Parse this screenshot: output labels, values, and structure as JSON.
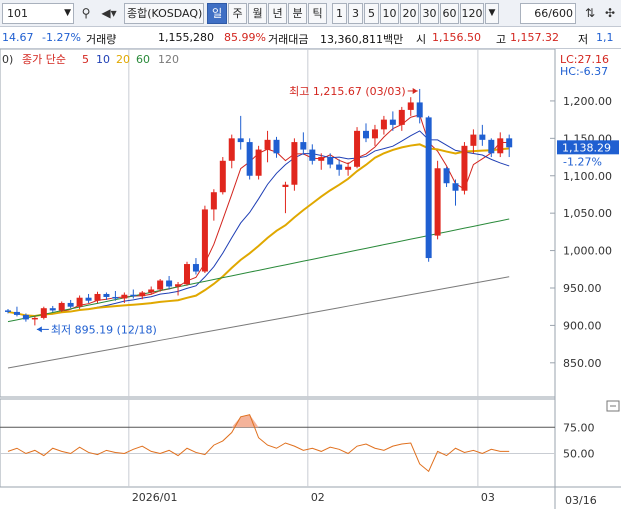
{
  "toolbar": {
    "code": "101",
    "market": "종합(KOSDAQ)",
    "periods": [
      "일",
      "주",
      "월",
      "년",
      "분",
      "틱"
    ],
    "active_period": "일",
    "intervals": [
      "1",
      "3",
      "5",
      "10",
      "20",
      "30",
      "60",
      "120"
    ],
    "bars_count": "66",
    "bars_total": "/600"
  },
  "quote": {
    "change": "14.67",
    "change_pct": "-1.27%",
    "volume_label": "거래량",
    "volume": "1,155,280",
    "volume_ratio": "85.99%",
    "amount_label": "거래대금",
    "amount": "13,360,811백만",
    "open_label": "시",
    "open": "1,156.50",
    "high_label": "고",
    "high": "1,157.32",
    "low_label": "저",
    "low_partial": "1,1"
  },
  "legend": {
    "prefix": "0)",
    "title": "종가 단순",
    "ma": [
      {
        "label": "5",
        "color": "#d3261f"
      },
      {
        "label": "10",
        "color": "#1f3fb5"
      },
      {
        "label": "20",
        "color": "#e0a800"
      },
      {
        "label": "60",
        "color": "#2a8a3a"
      },
      {
        "label": "120",
        "color": "#7a7a7a"
      }
    ]
  },
  "chart_data": {
    "type": "candlestick",
    "price_axis": [
      1200,
      1150,
      1100,
      1050,
      1000,
      950,
      900,
      850
    ],
    "price_axis_labels": [
      "1,200.00",
      "1,150.00",
      "1,100.00",
      "1,050.00",
      "1,000.00",
      "950.00",
      "900.00",
      "850.00"
    ],
    "ylim": [
      815,
      1240
    ],
    "current_price": "1,138.29",
    "current_change": "-1.27%",
    "lc": "LC:27.16",
    "hc": "HC:-6.37",
    "high_annotation": "최고 1,215.67 (03/03)",
    "low_annotation": "최저 895.19 (12/18)",
    "x_labels": [
      {
        "text": "2026/01",
        "index": 14
      },
      {
        "text": "02",
        "index": 34
      },
      {
        "text": "03",
        "index": 53
      }
    ],
    "date_label": "03/16",
    "candles": [
      [
        920,
        922,
        916,
        918
      ],
      [
        918,
        925,
        912,
        914
      ],
      [
        914,
        916,
        905,
        908
      ],
      [
        908,
        912,
        900,
        910
      ],
      [
        910,
        925,
        908,
        923
      ],
      [
        923,
        926,
        918,
        920
      ],
      [
        920,
        932,
        918,
        930
      ],
      [
        930,
        934,
        923,
        925
      ],
      [
        925,
        940,
        922,
        937
      ],
      [
        937,
        942,
        930,
        933
      ],
      [
        933,
        945,
        930,
        942
      ],
      [
        942,
        944,
        934,
        938
      ],
      [
        938,
        946,
        933,
        936
      ],
      [
        936,
        944,
        930,
        941
      ],
      [
        941,
        948,
        936,
        939
      ],
      [
        939,
        946,
        935,
        944
      ],
      [
        944,
        952,
        941,
        948
      ],
      [
        948,
        962,
        945,
        960
      ],
      [
        960,
        966,
        948,
        952
      ],
      [
        952,
        958,
        940,
        955
      ],
      [
        955,
        985,
        953,
        982
      ],
      [
        982,
        990,
        968,
        972
      ],
      [
        972,
        1060,
        970,
        1055
      ],
      [
        1055,
        1082,
        1040,
        1078
      ],
      [
        1078,
        1125,
        1075,
        1120
      ],
      [
        1120,
        1155,
        1110,
        1150
      ],
      [
        1150,
        1180,
        1135,
        1145
      ],
      [
        1145,
        1150,
        1095,
        1100
      ],
      [
        1100,
        1140,
        1095,
        1135
      ],
      [
        1135,
        1160,
        1118,
        1148
      ],
      [
        1148,
        1152,
        1124,
        1130
      ],
      [
        1085,
        1092,
        1050,
        1088
      ],
      [
        1088,
        1150,
        1080,
        1145
      ],
      [
        1145,
        1158,
        1128,
        1135
      ],
      [
        1135,
        1142,
        1115,
        1120
      ],
      [
        1120,
        1130,
        1108,
        1125
      ],
      [
        1125,
        1130,
        1110,
        1115
      ],
      [
        1115,
        1122,
        1100,
        1108
      ],
      [
        1108,
        1118,
        1100,
        1112
      ],
      [
        1112,
        1165,
        1110,
        1160
      ],
      [
        1160,
        1170,
        1145,
        1150
      ],
      [
        1150,
        1168,
        1140,
        1162
      ],
      [
        1162,
        1180,
        1155,
        1175
      ],
      [
        1175,
        1186,
        1160,
        1168
      ],
      [
        1168,
        1192,
        1160,
        1188
      ],
      [
        1188,
        1205,
        1180,
        1198
      ],
      [
        1198,
        1216,
        1170,
        1178
      ],
      [
        1178,
        1180,
        985,
        990
      ],
      [
        1020,
        1120,
        1015,
        1110
      ],
      [
        1110,
        1112,
        1085,
        1090
      ],
      [
        1090,
        1095,
        1060,
        1080
      ],
      [
        1080,
        1145,
        1075,
        1140
      ],
      [
        1140,
        1162,
        1130,
        1155
      ],
      [
        1155,
        1168,
        1140,
        1148
      ],
      [
        1148,
        1150,
        1125,
        1130
      ],
      [
        1130,
        1158,
        1125,
        1150
      ],
      [
        1150,
        1155,
        1125,
        1138
      ]
    ],
    "sub_axis": [
      75,
      50
    ],
    "sub_axis_labels": [
      "75.00",
      "50.00"
    ],
    "sub_ylim": [
      20,
      100
    ],
    "sub_series": [
      52,
      55,
      50,
      53,
      48,
      55,
      52,
      50,
      56,
      51,
      49,
      53,
      51,
      50,
      54,
      57,
      52,
      50,
      53,
      48,
      55,
      51,
      49,
      58,
      62,
      70,
      85,
      87,
      65,
      58,
      55,
      60,
      57,
      53,
      55,
      52,
      56,
      54,
      50,
      57,
      59,
      55,
      53,
      57,
      59,
      60,
      40,
      33,
      52,
      48,
      55,
      51,
      53,
      50,
      54,
      52,
      52
    ]
  }
}
